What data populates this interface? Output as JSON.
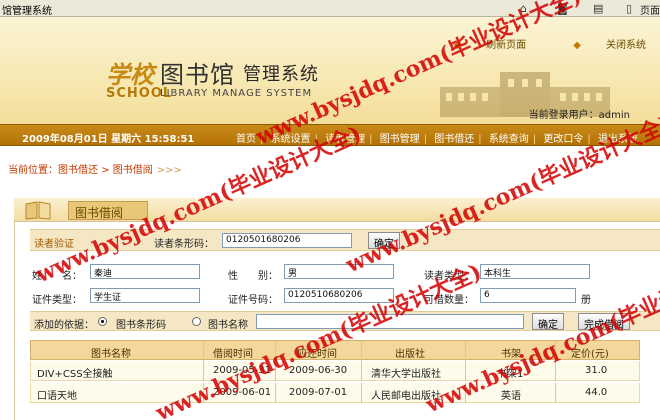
{
  "browser": {
    "window_title": "馆管理系统",
    "page_label": "页面"
  },
  "header": {
    "links": [
      "刷新页面",
      "关闭系统"
    ],
    "logo": {
      "school": "学校",
      "library_cn": "图书馆",
      "management": "管理系统",
      "school_en": "SCHOOL",
      "library_en": "LIBRARY MANAGE SYSTEM"
    },
    "current_user_label": "当前登录用户：",
    "current_user": "admin"
  },
  "nav": {
    "datetime": "2009年08月01日  星期六  15:58:51",
    "items": [
      "首页",
      "系统设置",
      "读者管理",
      "图书管理",
      "图书借还",
      "系统查询",
      "更改口令",
      "退出系统"
    ]
  },
  "location": {
    "prefix": "当前位置：",
    "path": "图书借还 > 图书借阅",
    "arrows": ">>>"
  },
  "panel": {
    "title": "图书借阅"
  },
  "reader_verify": {
    "section_label": "读者验证",
    "barcode_label": "读者条形码：",
    "barcode_value": "0120501680206",
    "confirm_label": "确定"
  },
  "reader_info": {
    "name_label": "姓　　名：",
    "name_value": "秦迪",
    "gender_label": "性　　别：",
    "gender_value": "男",
    "type_label": "读者类型：",
    "type_value": "本科生",
    "cert_type_label": "证件类型：",
    "cert_type_value": "学生证",
    "cert_no_label": "证件号码：",
    "cert_no_value": "0120510680206",
    "borrow_count_label": "可借数量：",
    "borrow_count_value": "6",
    "borrow_unit": "册"
  },
  "search": {
    "basis_label": "添加的依据：",
    "option_barcode": "图书条形码",
    "option_name": "图书名称",
    "selected": "barcode",
    "confirm_label": "确定",
    "finish_label": "完成借阅"
  },
  "table": {
    "headers": [
      "图书名称",
      "借阅时间",
      "应还时间",
      "出版社",
      "书架",
      "定价(元)"
    ],
    "rows": [
      [
        "DIV+CSS全接触",
        "2009-05-31",
        "2009-06-30",
        "清华大学出版社",
        "书架1",
        "31.0"
      ],
      [
        "口语天地",
        "2009-06-01",
        "2009-07-01",
        "人民邮电出版社",
        "英语",
        "44.0"
      ]
    ]
  },
  "watermarks": [
    "www.bysjdq.com(毕业设计大全)",
    "www.bysjdq.com(毕业设计大全)",
    "www.bysjdq.com(毕业设计大全)",
    "www.bysjdq.com(毕业设计大全)",
    "www.bysjdq.com(毕业设计大全)"
  ]
}
